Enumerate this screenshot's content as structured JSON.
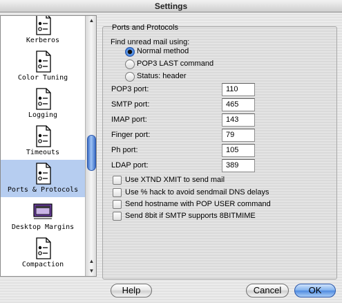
{
  "window": {
    "title": "Settings"
  },
  "sidebar": {
    "items": [
      {
        "label": "Kerberos",
        "icon": "document-switch-icon",
        "selected": false
      },
      {
        "label": "Color Tuning",
        "icon": "document-switch-icon",
        "selected": false
      },
      {
        "label": "Logging",
        "icon": "document-switch-icon",
        "selected": false
      },
      {
        "label": "Timeouts",
        "icon": "document-switch-icon",
        "selected": false
      },
      {
        "label": "Ports & Protocols",
        "icon": "document-switch-icon",
        "selected": true
      },
      {
        "label": "Desktop Margins",
        "icon": "screen-margins-icon",
        "selected": false
      },
      {
        "label": "Compaction",
        "icon": "document-switch-icon",
        "selected": false
      }
    ]
  },
  "panel": {
    "title": "Ports and Protocols",
    "find_unread_label": "Find unread mail using:",
    "radio_options": [
      {
        "label": "Normal method",
        "selected": true
      },
      {
        "label": "POP3 LAST command",
        "selected": false
      },
      {
        "label": "Status: header",
        "selected": false
      }
    ],
    "ports": [
      {
        "label": "POP3 port:",
        "value": "110"
      },
      {
        "label": "SMTP port:",
        "value": "465"
      },
      {
        "label": "IMAP port:",
        "value": "143"
      },
      {
        "label": "Finger port:",
        "value": "79"
      },
      {
        "label": "Ph port:",
        "value": "105"
      },
      {
        "label": "LDAP port:",
        "value": "389"
      }
    ],
    "checkboxes": [
      {
        "label": "Use XTND XMIT to send mail",
        "checked": false
      },
      {
        "label": "Use % hack to avoid sendmail DNS delays",
        "checked": false
      },
      {
        "label": "Send hostname with POP USER command",
        "checked": false
      },
      {
        "label": "Send 8bit if SMTP supports 8BITMIME",
        "checked": false
      }
    ]
  },
  "buttons": {
    "help": "Help",
    "cancel": "Cancel",
    "ok": "OK"
  },
  "colors": {
    "selection": "#b6cdf0",
    "accent": "#3d6fc8"
  }
}
